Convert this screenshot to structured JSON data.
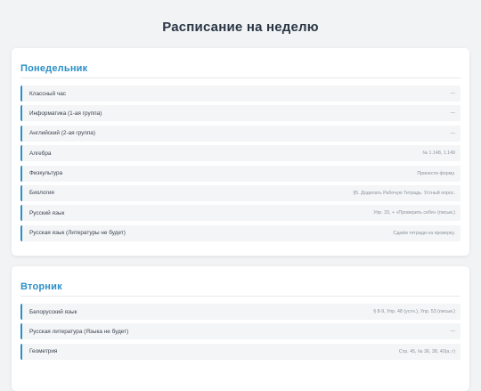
{
  "page": {
    "title": "Расписание на неделю"
  },
  "days": [
    {
      "name": "Понедельник",
      "lessons": [
        {
          "subject": "Классный час",
          "homework": "—"
        },
        {
          "subject": "Информатика (1-ая группа)",
          "homework": "—"
        },
        {
          "subject": "Английский (2-ая группа)",
          "homework": "—"
        },
        {
          "subject": "Алгебра",
          "homework": "№ 1.148, 1.149"
        },
        {
          "subject": "Физкультура",
          "homework": "Принести форму."
        },
        {
          "subject": "Биология",
          "homework": "§5. Доделать Рабочую Тетрадь. Устный опрос."
        },
        {
          "subject": "Русский язык",
          "homework": "Упр. 33, + «Проверить себя» (письм.)"
        },
        {
          "subject": "Русская язык (Литературы не будет)",
          "homework": "Сдаём тетради на проверку."
        }
      ]
    },
    {
      "name": "Вторник",
      "lessons": [
        {
          "subject": "Белорусский язык",
          "homework": "§ 8-9, Упр. 48 (устн.), Упр. 53 (письм.)"
        },
        {
          "subject": "Русская литература (Языка не будет)",
          "homework": "—"
        },
        {
          "subject": "Геометрия",
          "homework": "Стр. 45, № 36, 38, 40(а, г)"
        }
      ]
    }
  ],
  "colors": {
    "accent": "#2a8fc7",
    "title": "#2b3645",
    "background": "#f1f3f5"
  }
}
